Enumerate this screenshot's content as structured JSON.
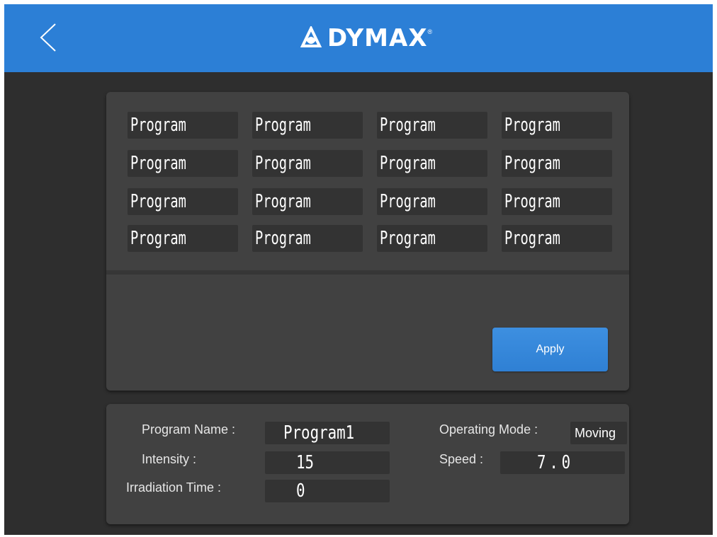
{
  "header": {
    "back_icon": "chevron-left-icon",
    "logo_text": "DYMAX",
    "logo_reg": "®",
    "color": "#2c7fd6"
  },
  "programs": [
    [
      "Program",
      "Program",
      "Program",
      "Program"
    ],
    [
      "Program",
      "Program",
      "Program",
      "Program"
    ],
    [
      "Program",
      "Program",
      "Program",
      "Program"
    ],
    [
      "Program",
      "Program",
      "Program",
      "Program"
    ]
  ],
  "apply_label": "Apply",
  "details": {
    "program_name_label": "Program Name :",
    "program_name_value": "Program1",
    "intensity_label": "Intensity :",
    "intensity_value": "15",
    "irradiation_label": "Irradiation Time :",
    "irradiation_value": "0",
    "mode_label": "Operating Mode :",
    "mode_value": "Moving",
    "speed_label": "Speed :",
    "speed_value": "7.0"
  }
}
